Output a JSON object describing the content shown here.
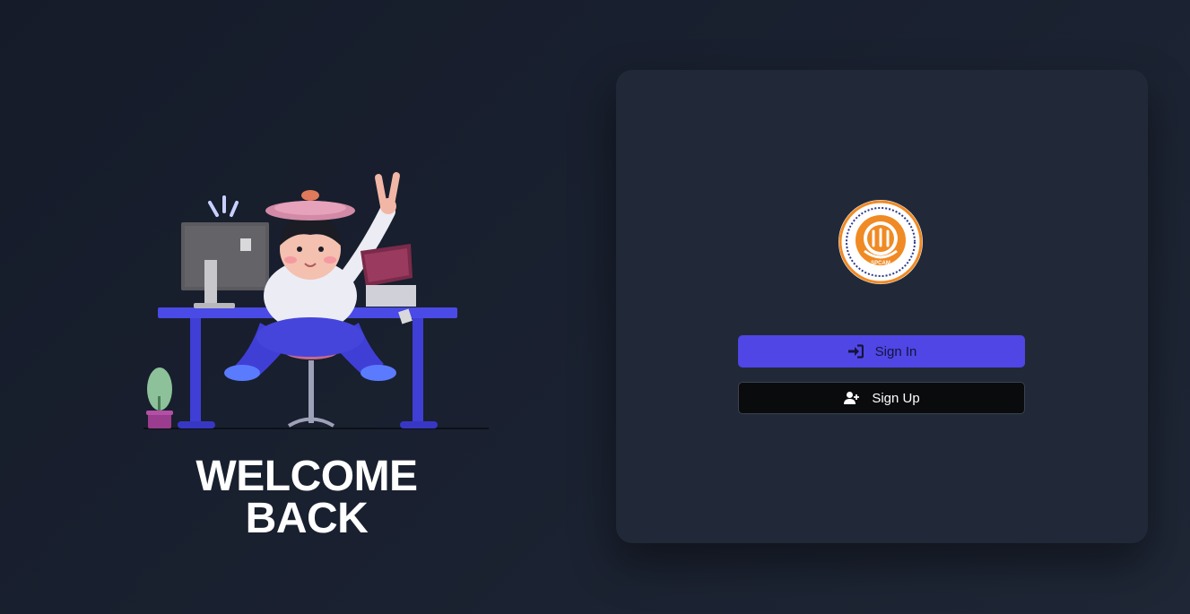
{
  "welcome": {
    "line1": "WELCOME",
    "line2": "BACK"
  },
  "illustration": {
    "icon": "person-at-desk-illustration"
  },
  "logo": {
    "icon": "spcam-emblem-logo",
    "text": "SPCAM"
  },
  "auth": {
    "sign_in_label": "Sign In",
    "sign_in_icon": "sign-in-icon",
    "sign_up_label": "Sign Up",
    "sign_up_icon": "user-plus-icon"
  },
  "colors": {
    "background": "#171d2a",
    "card": "#212938",
    "primary": "#4f46e5",
    "secondary": "#0a0b0d",
    "logo_orange": "#f08a24",
    "logo_blue": "#2b3a8c"
  }
}
